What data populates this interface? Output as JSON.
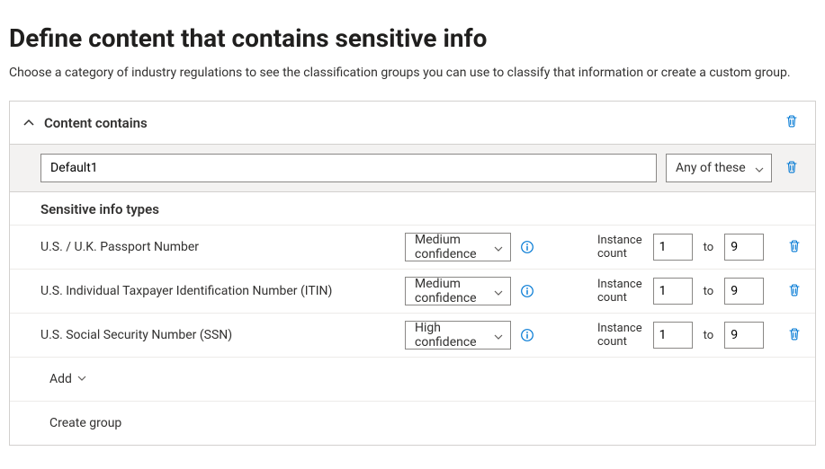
{
  "title": "Define content that contains sensitive info",
  "subtitle": "Choose a category of industry regulations to see the classification groups you can use to classify that information or create a custom group.",
  "section_title": "Content contains",
  "group": {
    "name": "Default1",
    "match_mode": "Any of these"
  },
  "sensitive_header": "Sensitive info types",
  "rows": [
    {
      "name": "U.S. / U.K. Passport Number",
      "confidence": "Medium confidence",
      "count_label": "Instance count",
      "min": "1",
      "to": "to",
      "max": "9"
    },
    {
      "name": "U.S. Individual Taxpayer Identification Number (ITIN)",
      "confidence": "Medium confidence",
      "count_label": "Instance count",
      "min": "1",
      "to": "to",
      "max": "9"
    },
    {
      "name": "U.S. Social Security Number (SSN)",
      "confidence": "High confidence",
      "count_label": "Instance count",
      "min": "1",
      "to": "to",
      "max": "9"
    }
  ],
  "add_label": "Add",
  "create_group_label": "Create group"
}
